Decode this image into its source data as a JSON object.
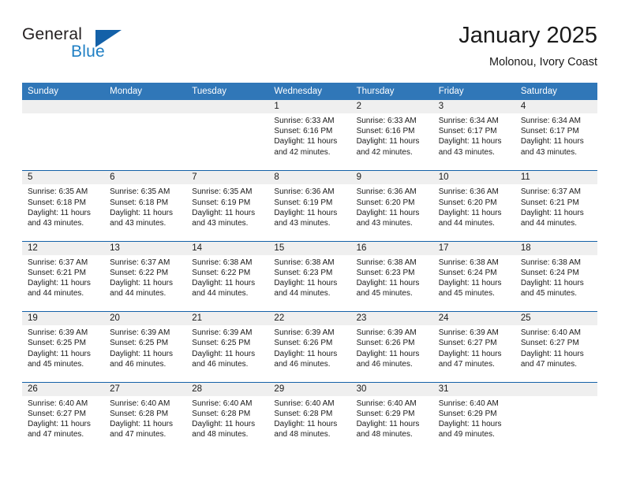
{
  "brand": {
    "name_part1": "General",
    "name_part2": "Blue",
    "logo_icon": "blue-triangle-logo"
  },
  "header": {
    "title": "January 2025",
    "location": "Molonou, Ivory Coast"
  },
  "colors": {
    "header_blue": "#3077b8",
    "row_divider_blue": "#1461a8",
    "day_band_gray": "#efefef",
    "brand_blue": "#1f7fc4",
    "text": "#1a1a1a"
  },
  "weekdays": [
    "Sunday",
    "Monday",
    "Tuesday",
    "Wednesday",
    "Thursday",
    "Friday",
    "Saturday"
  ],
  "weeks": [
    [
      {
        "day": "",
        "empty": true,
        "sunrise": "",
        "sunset": "",
        "daylight_line1": "",
        "daylight_line2": ""
      },
      {
        "day": "",
        "empty": true,
        "sunrise": "",
        "sunset": "",
        "daylight_line1": "",
        "daylight_line2": ""
      },
      {
        "day": "",
        "empty": true,
        "sunrise": "",
        "sunset": "",
        "daylight_line1": "",
        "daylight_line2": ""
      },
      {
        "day": "1",
        "empty": false,
        "sunrise": "Sunrise: 6:33 AM",
        "sunset": "Sunset: 6:16 PM",
        "daylight_line1": "Daylight: 11 hours",
        "daylight_line2": "and 42 minutes."
      },
      {
        "day": "2",
        "empty": false,
        "sunrise": "Sunrise: 6:33 AM",
        "sunset": "Sunset: 6:16 PM",
        "daylight_line1": "Daylight: 11 hours",
        "daylight_line2": "and 42 minutes."
      },
      {
        "day": "3",
        "empty": false,
        "sunrise": "Sunrise: 6:34 AM",
        "sunset": "Sunset: 6:17 PM",
        "daylight_line1": "Daylight: 11 hours",
        "daylight_line2": "and 43 minutes."
      },
      {
        "day": "4",
        "empty": false,
        "sunrise": "Sunrise: 6:34 AM",
        "sunset": "Sunset: 6:17 PM",
        "daylight_line1": "Daylight: 11 hours",
        "daylight_line2": "and 43 minutes."
      }
    ],
    [
      {
        "day": "5",
        "empty": false,
        "sunrise": "Sunrise: 6:35 AM",
        "sunset": "Sunset: 6:18 PM",
        "daylight_line1": "Daylight: 11 hours",
        "daylight_line2": "and 43 minutes."
      },
      {
        "day": "6",
        "empty": false,
        "sunrise": "Sunrise: 6:35 AM",
        "sunset": "Sunset: 6:18 PM",
        "daylight_line1": "Daylight: 11 hours",
        "daylight_line2": "and 43 minutes."
      },
      {
        "day": "7",
        "empty": false,
        "sunrise": "Sunrise: 6:35 AM",
        "sunset": "Sunset: 6:19 PM",
        "daylight_line1": "Daylight: 11 hours",
        "daylight_line2": "and 43 minutes."
      },
      {
        "day": "8",
        "empty": false,
        "sunrise": "Sunrise: 6:36 AM",
        "sunset": "Sunset: 6:19 PM",
        "daylight_line1": "Daylight: 11 hours",
        "daylight_line2": "and 43 minutes."
      },
      {
        "day": "9",
        "empty": false,
        "sunrise": "Sunrise: 6:36 AM",
        "sunset": "Sunset: 6:20 PM",
        "daylight_line1": "Daylight: 11 hours",
        "daylight_line2": "and 43 minutes."
      },
      {
        "day": "10",
        "empty": false,
        "sunrise": "Sunrise: 6:36 AM",
        "sunset": "Sunset: 6:20 PM",
        "daylight_line1": "Daylight: 11 hours",
        "daylight_line2": "and 44 minutes."
      },
      {
        "day": "11",
        "empty": false,
        "sunrise": "Sunrise: 6:37 AM",
        "sunset": "Sunset: 6:21 PM",
        "daylight_line1": "Daylight: 11 hours",
        "daylight_line2": "and 44 minutes."
      }
    ],
    [
      {
        "day": "12",
        "empty": false,
        "sunrise": "Sunrise: 6:37 AM",
        "sunset": "Sunset: 6:21 PM",
        "daylight_line1": "Daylight: 11 hours",
        "daylight_line2": "and 44 minutes."
      },
      {
        "day": "13",
        "empty": false,
        "sunrise": "Sunrise: 6:37 AM",
        "sunset": "Sunset: 6:22 PM",
        "daylight_line1": "Daylight: 11 hours",
        "daylight_line2": "and 44 minutes."
      },
      {
        "day": "14",
        "empty": false,
        "sunrise": "Sunrise: 6:38 AM",
        "sunset": "Sunset: 6:22 PM",
        "daylight_line1": "Daylight: 11 hours",
        "daylight_line2": "and 44 minutes."
      },
      {
        "day": "15",
        "empty": false,
        "sunrise": "Sunrise: 6:38 AM",
        "sunset": "Sunset: 6:23 PM",
        "daylight_line1": "Daylight: 11 hours",
        "daylight_line2": "and 44 minutes."
      },
      {
        "day": "16",
        "empty": false,
        "sunrise": "Sunrise: 6:38 AM",
        "sunset": "Sunset: 6:23 PM",
        "daylight_line1": "Daylight: 11 hours",
        "daylight_line2": "and 45 minutes."
      },
      {
        "day": "17",
        "empty": false,
        "sunrise": "Sunrise: 6:38 AM",
        "sunset": "Sunset: 6:24 PM",
        "daylight_line1": "Daylight: 11 hours",
        "daylight_line2": "and 45 minutes."
      },
      {
        "day": "18",
        "empty": false,
        "sunrise": "Sunrise: 6:38 AM",
        "sunset": "Sunset: 6:24 PM",
        "daylight_line1": "Daylight: 11 hours",
        "daylight_line2": "and 45 minutes."
      }
    ],
    [
      {
        "day": "19",
        "empty": false,
        "sunrise": "Sunrise: 6:39 AM",
        "sunset": "Sunset: 6:25 PM",
        "daylight_line1": "Daylight: 11 hours",
        "daylight_line2": "and 45 minutes."
      },
      {
        "day": "20",
        "empty": false,
        "sunrise": "Sunrise: 6:39 AM",
        "sunset": "Sunset: 6:25 PM",
        "daylight_line1": "Daylight: 11 hours",
        "daylight_line2": "and 46 minutes."
      },
      {
        "day": "21",
        "empty": false,
        "sunrise": "Sunrise: 6:39 AM",
        "sunset": "Sunset: 6:25 PM",
        "daylight_line1": "Daylight: 11 hours",
        "daylight_line2": "and 46 minutes."
      },
      {
        "day": "22",
        "empty": false,
        "sunrise": "Sunrise: 6:39 AM",
        "sunset": "Sunset: 6:26 PM",
        "daylight_line1": "Daylight: 11 hours",
        "daylight_line2": "and 46 minutes."
      },
      {
        "day": "23",
        "empty": false,
        "sunrise": "Sunrise: 6:39 AM",
        "sunset": "Sunset: 6:26 PM",
        "daylight_line1": "Daylight: 11 hours",
        "daylight_line2": "and 46 minutes."
      },
      {
        "day": "24",
        "empty": false,
        "sunrise": "Sunrise: 6:39 AM",
        "sunset": "Sunset: 6:27 PM",
        "daylight_line1": "Daylight: 11 hours",
        "daylight_line2": "and 47 minutes."
      },
      {
        "day": "25",
        "empty": false,
        "sunrise": "Sunrise: 6:40 AM",
        "sunset": "Sunset: 6:27 PM",
        "daylight_line1": "Daylight: 11 hours",
        "daylight_line2": "and 47 minutes."
      }
    ],
    [
      {
        "day": "26",
        "empty": false,
        "sunrise": "Sunrise: 6:40 AM",
        "sunset": "Sunset: 6:27 PM",
        "daylight_line1": "Daylight: 11 hours",
        "daylight_line2": "and 47 minutes."
      },
      {
        "day": "27",
        "empty": false,
        "sunrise": "Sunrise: 6:40 AM",
        "sunset": "Sunset: 6:28 PM",
        "daylight_line1": "Daylight: 11 hours",
        "daylight_line2": "and 47 minutes."
      },
      {
        "day": "28",
        "empty": false,
        "sunrise": "Sunrise: 6:40 AM",
        "sunset": "Sunset: 6:28 PM",
        "daylight_line1": "Daylight: 11 hours",
        "daylight_line2": "and 48 minutes."
      },
      {
        "day": "29",
        "empty": false,
        "sunrise": "Sunrise: 6:40 AM",
        "sunset": "Sunset: 6:28 PM",
        "daylight_line1": "Daylight: 11 hours",
        "daylight_line2": "and 48 minutes."
      },
      {
        "day": "30",
        "empty": false,
        "sunrise": "Sunrise: 6:40 AM",
        "sunset": "Sunset: 6:29 PM",
        "daylight_line1": "Daylight: 11 hours",
        "daylight_line2": "and 48 minutes."
      },
      {
        "day": "31",
        "empty": false,
        "sunrise": "Sunrise: 6:40 AM",
        "sunset": "Sunset: 6:29 PM",
        "daylight_line1": "Daylight: 11 hours",
        "daylight_line2": "and 49 minutes."
      },
      {
        "day": "",
        "empty": true,
        "sunrise": "",
        "sunset": "",
        "daylight_line1": "",
        "daylight_line2": ""
      }
    ]
  ]
}
